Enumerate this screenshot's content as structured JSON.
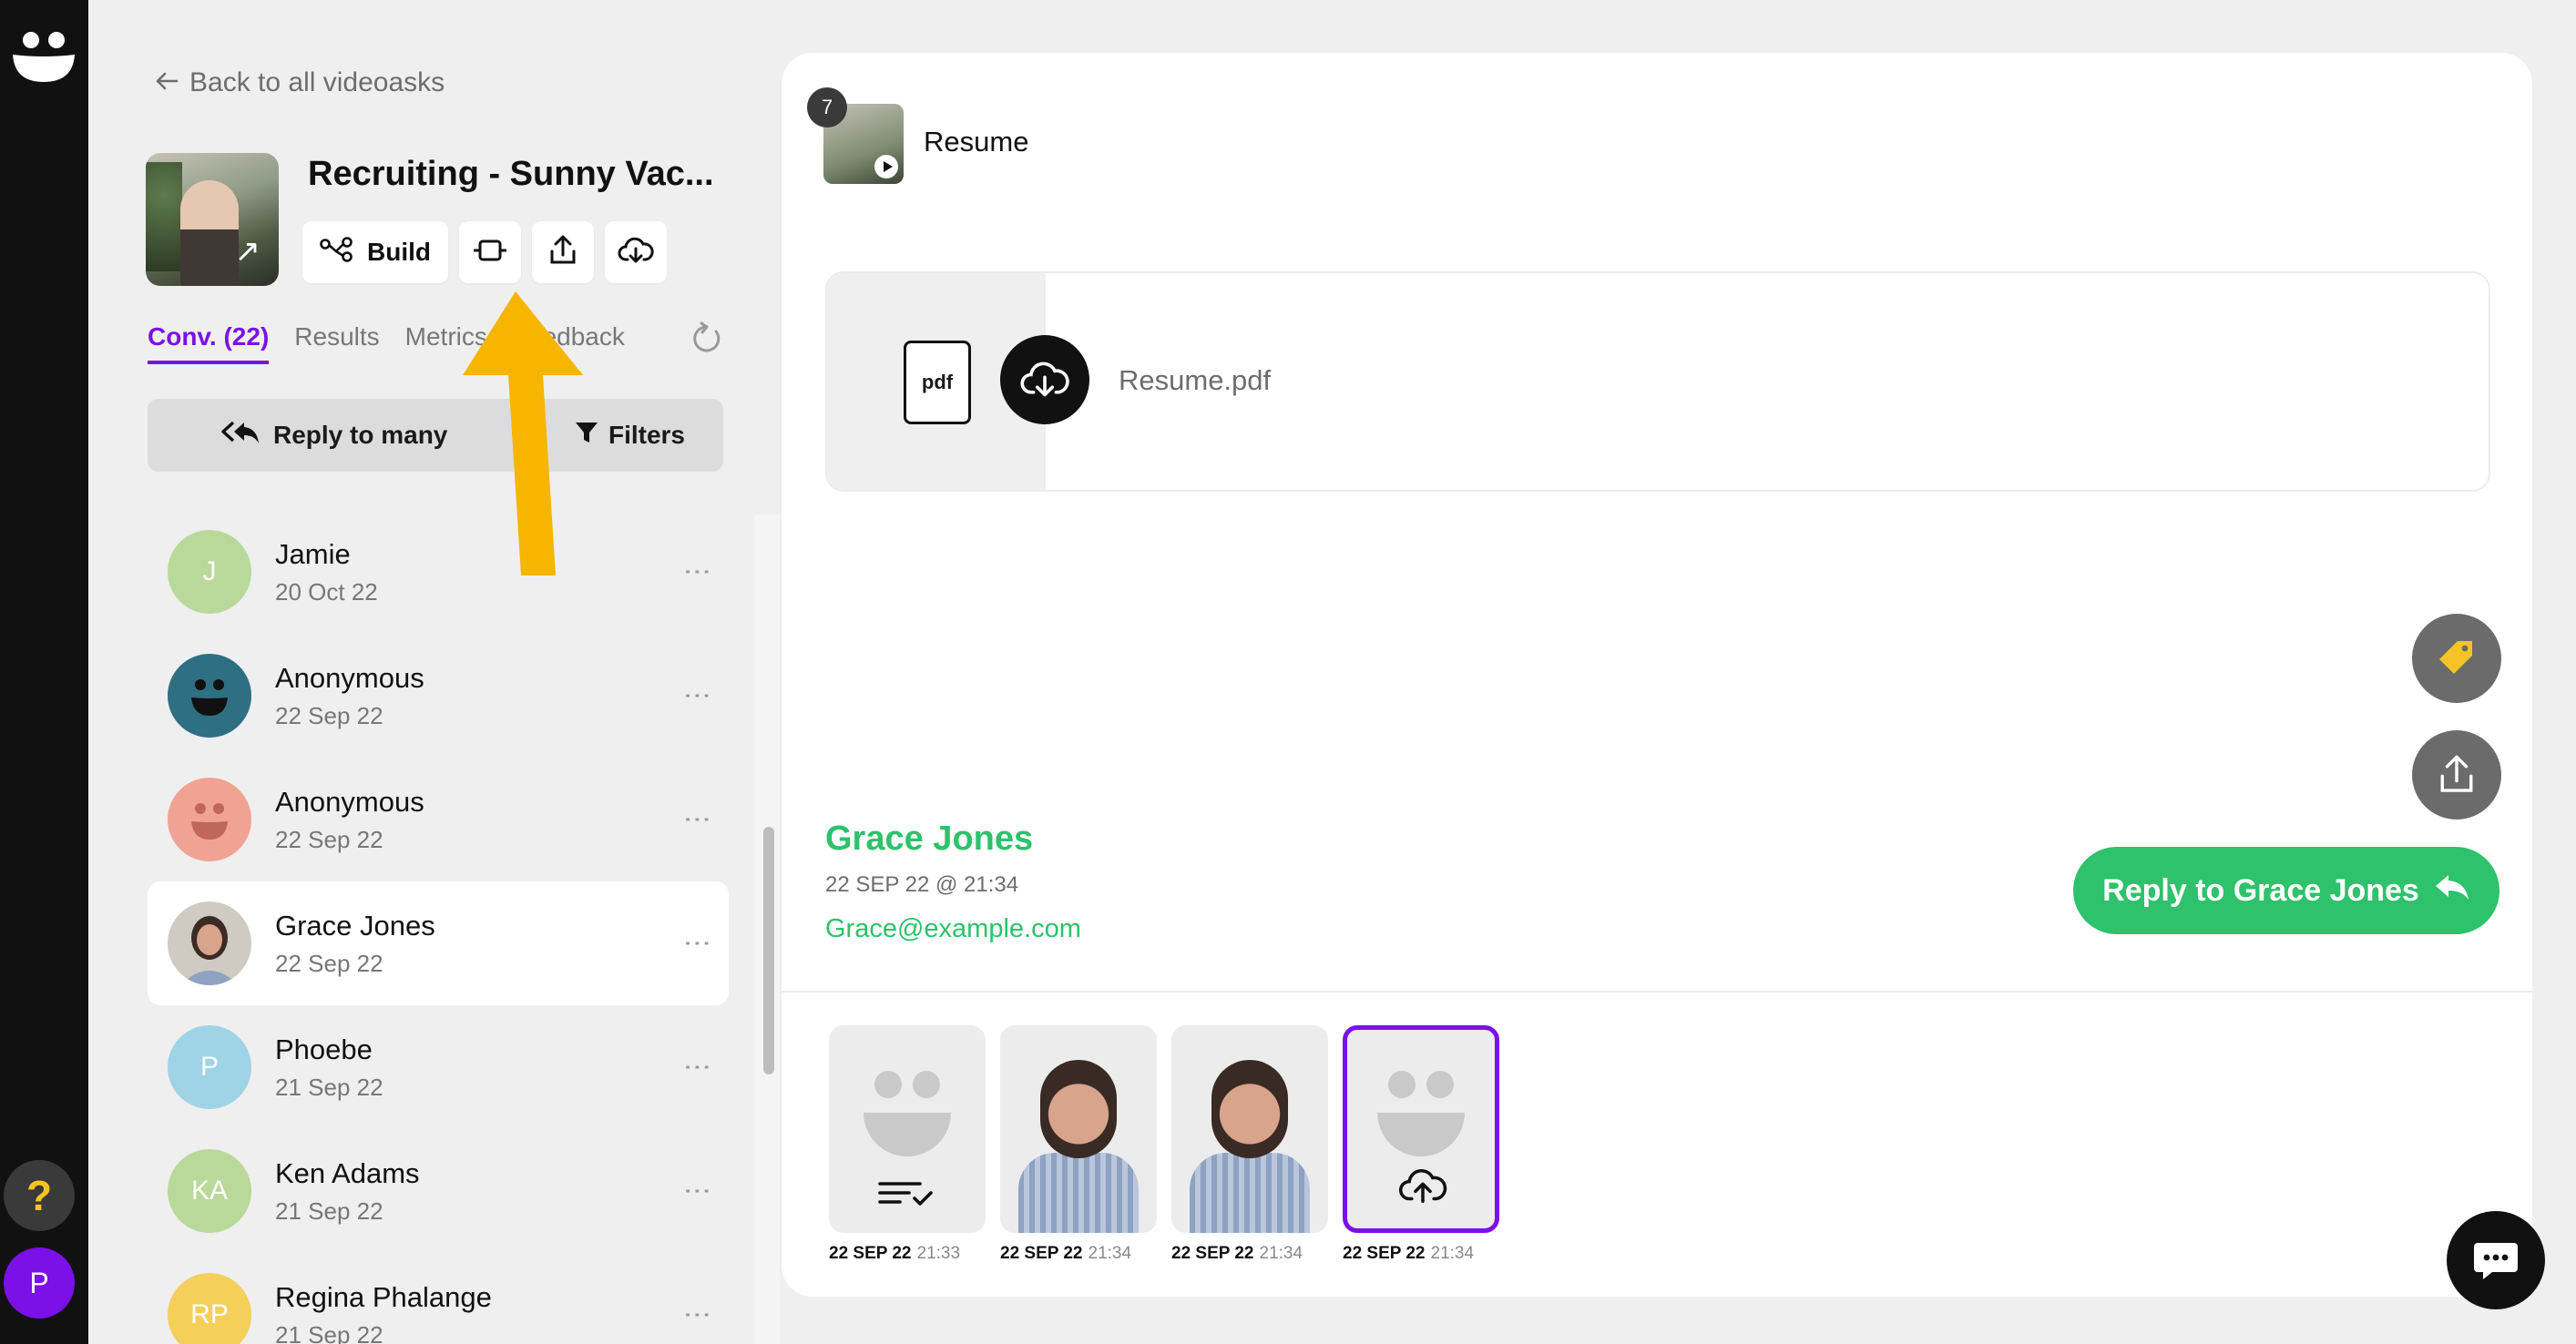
{
  "nav": {
    "back_label": "Back to all videoasks",
    "help_glyph": "?",
    "user_initial": "P"
  },
  "videoask": {
    "title": "Recruiting - Sunny Vac...",
    "build_label": "Build"
  },
  "tabs": [
    "Conv. (22)",
    "Results",
    "Metrics",
    "Feedback"
  ],
  "actions": {
    "reply_many": "Reply to many",
    "filters": "Filters"
  },
  "conversations": [
    {
      "initials": "J",
      "name": "Jamie",
      "date": "20 Oct 22",
      "color": "#b9d99b"
    },
    {
      "initials": "",
      "name": "Anonymous",
      "date": "22 Sep 22",
      "color": "#2f6f82"
    },
    {
      "initials": "",
      "name": "Anonymous",
      "date": "22 Sep 22",
      "color": "#f0a394"
    },
    {
      "initials": "",
      "name": "Grace Jones",
      "date": "22 Sep 22",
      "color": "#9a9a9a"
    },
    {
      "initials": "P",
      "name": "Phoebe",
      "date": "21 Sep 22",
      "color": "#9fd4e6"
    },
    {
      "initials": "KA",
      "name": "Ken Adams",
      "date": "21 Sep 22",
      "color": "#b9d99b"
    },
    {
      "initials": "RP",
      "name": "Regina Phalange",
      "date": "21 Sep 22",
      "color": "#f4cf5c"
    }
  ],
  "question": {
    "number": "7",
    "label": "Resume"
  },
  "file": {
    "icon_label": "pdf",
    "name": "Resume.pdf"
  },
  "respondent": {
    "name": "Grace Jones",
    "datetime": "22 SEP 22 @ 21:34",
    "email": "Grace@example.com",
    "reply_label": "Reply to Grace Jones"
  },
  "steps": [
    {
      "date": "22 SEP 22",
      "time": "21:33",
      "kind": "text"
    },
    {
      "date": "22 SEP 22",
      "time": "21:34",
      "kind": "video"
    },
    {
      "date": "22 SEP 22",
      "time": "21:34",
      "kind": "video"
    },
    {
      "date": "22 SEP 22",
      "time": "21:34",
      "kind": "upload"
    }
  ],
  "colors": {
    "accent": "#7b10e8",
    "green": "#2dc26b",
    "annotation_arrow": "#f7b500"
  }
}
